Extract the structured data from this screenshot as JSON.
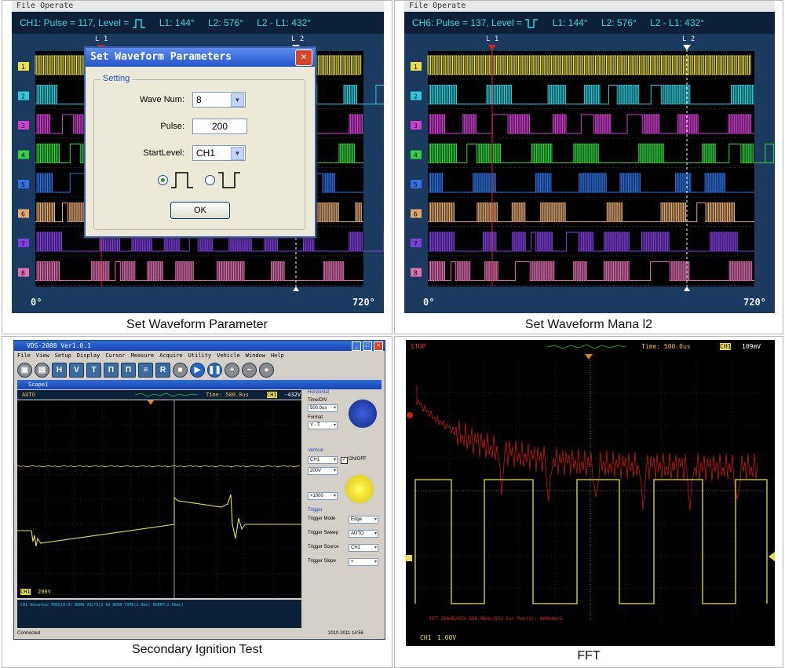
{
  "panels": [
    {
      "caption": "Set Waveform Parameter"
    },
    {
      "caption": "Set Waveform Mana l2"
    },
    {
      "caption": "Secondary Ignition Test"
    },
    {
      "caption": "FFT"
    }
  ],
  "logic1": {
    "menu": "File  Operate",
    "status": {
      "channel": "CH1: Pulse = 117, Level = ",
      "level_icon": "rising-pulse-icon",
      "l1": "L1: 144°",
      "l2": "L2: 576°",
      "diff": "L2 - L1: 432°"
    },
    "cursor_l1": "L 1",
    "cursor_l2": "L 2",
    "axis_start": "0°",
    "axis_end": "720°",
    "channels": [
      "1",
      "2",
      "3",
      "4",
      "5",
      "6",
      "7",
      "8"
    ],
    "channel_colors": [
      "#e8e040",
      "#30c8d8",
      "#d040d0",
      "#30d040",
      "#3070e0",
      "#e0a870",
      "#8040e0",
      "#e070b0"
    ],
    "dialog": {
      "title": "Set Waveform Parameters",
      "group_title": "Setting",
      "wave_num_label": "Wave Num:",
      "wave_num_value": "8",
      "pulse_label": "Pulse:",
      "pulse_value": "200",
      "start_level_label": "StartLevel:",
      "start_level_value": "CH1",
      "polarity_selected": "rising",
      "ok_label": "OK"
    }
  },
  "logic2": {
    "menu": "File  Operate",
    "status": {
      "channel": "CH6: Pulse = 137, Level = ",
      "level_icon": "falling-pulse-icon",
      "l1": "L1: 144°",
      "l2": "L2: 576°",
      "diff": "L2 - L1: 432°"
    },
    "cursor_l1": "L 1",
    "cursor_l2": "L 2",
    "axis_start": "0°",
    "axis_end": "720°",
    "channels": [
      "1",
      "2",
      "3",
      "4",
      "5",
      "6",
      "7",
      "8"
    ]
  },
  "ignition": {
    "window_title": "VDS-2088 Ver1.0.1",
    "menu_items": [
      "File",
      "View",
      "Setup",
      "Display",
      "Cursor",
      "Measure",
      "Acquire",
      "Utility",
      "Vehicle",
      "Window",
      "Help"
    ],
    "toolbar": [
      "H",
      "V",
      "T",
      "Π",
      "Π",
      "≡",
      "R"
    ],
    "sub_title": "Scope1",
    "run_state": "AUTO",
    "time_readout": "Time: 500.0us",
    "trigger_readout": "-432V",
    "ch_readout": "CH1",
    "ch_scale": "200V",
    "measure_text": "CH1 Advantec FREQ(H:8) BURN VOLTS(2 kV BURN TIME(3.0ms) BURNT(2.5kms)",
    "status_left": "Connected",
    "status_right": "2010-2011   14:56",
    "horizontal": {
      "group": "Horizontal",
      "label1": "Time/DIV",
      "value1": "500.0us",
      "label2": "Format",
      "value2": "Y - T"
    },
    "vertical": {
      "group": "Vertical",
      "channel": "CH1",
      "onoff": "ON/OFF",
      "scale": "200V",
      "probe": "×1000"
    },
    "trigger": {
      "group": "Trigger",
      "rows": [
        {
          "label": "Trigger Mode",
          "value": "Edge"
        },
        {
          "label": "Trigger Sweep",
          "value": "AUTO"
        },
        {
          "label": "Trigger Source",
          "value": "CH1"
        },
        {
          "label": "Trigger Slope",
          "value": "+"
        }
      ]
    }
  },
  "fft": {
    "run_state": "STOP",
    "time_readout": "Time: 500.0us",
    "ch_tag": "CH1",
    "trigger_readout": "109mV",
    "fft_label": "FFT    250dB/DIV     500.0kHz/DIV    Cur Pos(1): 600kHz/5",
    "ch_readout": "CH1",
    "ch_scale": "1.00V"
  }
}
